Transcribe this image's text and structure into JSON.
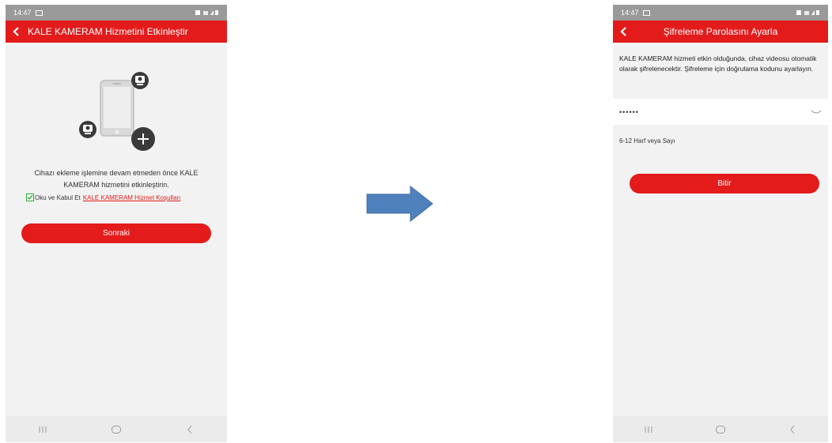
{
  "left_screen": {
    "status_time": "14:47",
    "title": "KALE KAMERAM Hizmetini Etkinleştir",
    "description": "Cihazı ekleme işlemine devam etmeden önce KALE KAMERAM hizmetini etkinleştirin.",
    "agree_text": "Oku ve Kabul Et",
    "terms_link": "KALE KAMERAM Hizmet Koşulları",
    "agree_checked": true,
    "next_button": "Sonraki"
  },
  "right_screen": {
    "status_time": "14:47",
    "title": "Şifreleme Parolasını Ayarla",
    "description": "KALE KAMERAM hizmeti etkin olduğunda, cihaz videosu otomatik olarak şifrelenecektir. Şifreleme için doğrulama kodunu ayarlayın.",
    "password_value": "••••••",
    "hint": "6-12 Harf veya Sayı",
    "finish_button": "Bitir"
  },
  "colors": {
    "brand_red": "#e31b1b",
    "status_bar_gray": "#9a9a9a",
    "arrow_blue": "#4f81bd",
    "checkbox_green": "#2aa52a"
  },
  "icons": [
    "back-arrow-icon",
    "phone-illustration-icon",
    "camera-icon",
    "plus-icon",
    "check-icon",
    "eye-closed-icon",
    "recent-apps-icon",
    "home-icon",
    "nav-back-icon",
    "right-arrow-icon"
  ]
}
